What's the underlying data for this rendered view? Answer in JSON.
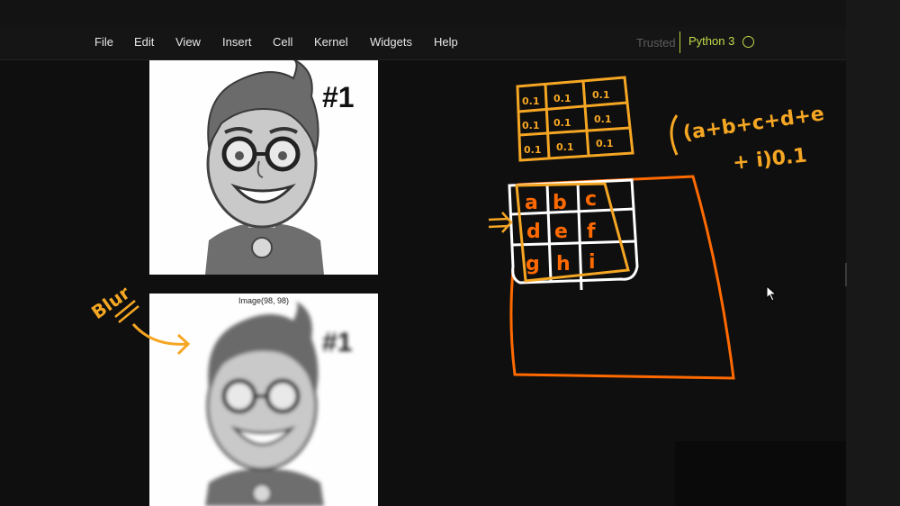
{
  "menu": {
    "items": [
      "File",
      "Edit",
      "View",
      "Insert",
      "Cell",
      "Kernel",
      "Widgets",
      "Help"
    ]
  },
  "kernel": {
    "trusted_label": "Trusted",
    "name": "Python 3",
    "status_icon": "kernel-idle-circle-icon"
  },
  "output": {
    "image1_label": "#1",
    "image2_caption": "Image(98, 98)",
    "image2_label": "#1"
  },
  "annotations": {
    "blur_label": "Blur",
    "kernel_grid": [
      [
        "0.1",
        "0.1",
        "0.1"
      ],
      [
        "0.1",
        "0.1",
        "0.1"
      ],
      [
        "0.1",
        "0.1",
        "0.1"
      ]
    ],
    "pixel_grid": [
      [
        "a",
        "b",
        "c"
      ],
      [
        "d",
        "e",
        "f"
      ],
      [
        "g",
        "h",
        "i"
      ]
    ],
    "formula_line1": "(a+b+c+d+e",
    "formula_line2": "+ i)0.1"
  },
  "colors": {
    "accent_kernel": "#c0dc4a",
    "ink_orange": "#f5a623",
    "ink_deep_orange": "#ff6a00"
  }
}
